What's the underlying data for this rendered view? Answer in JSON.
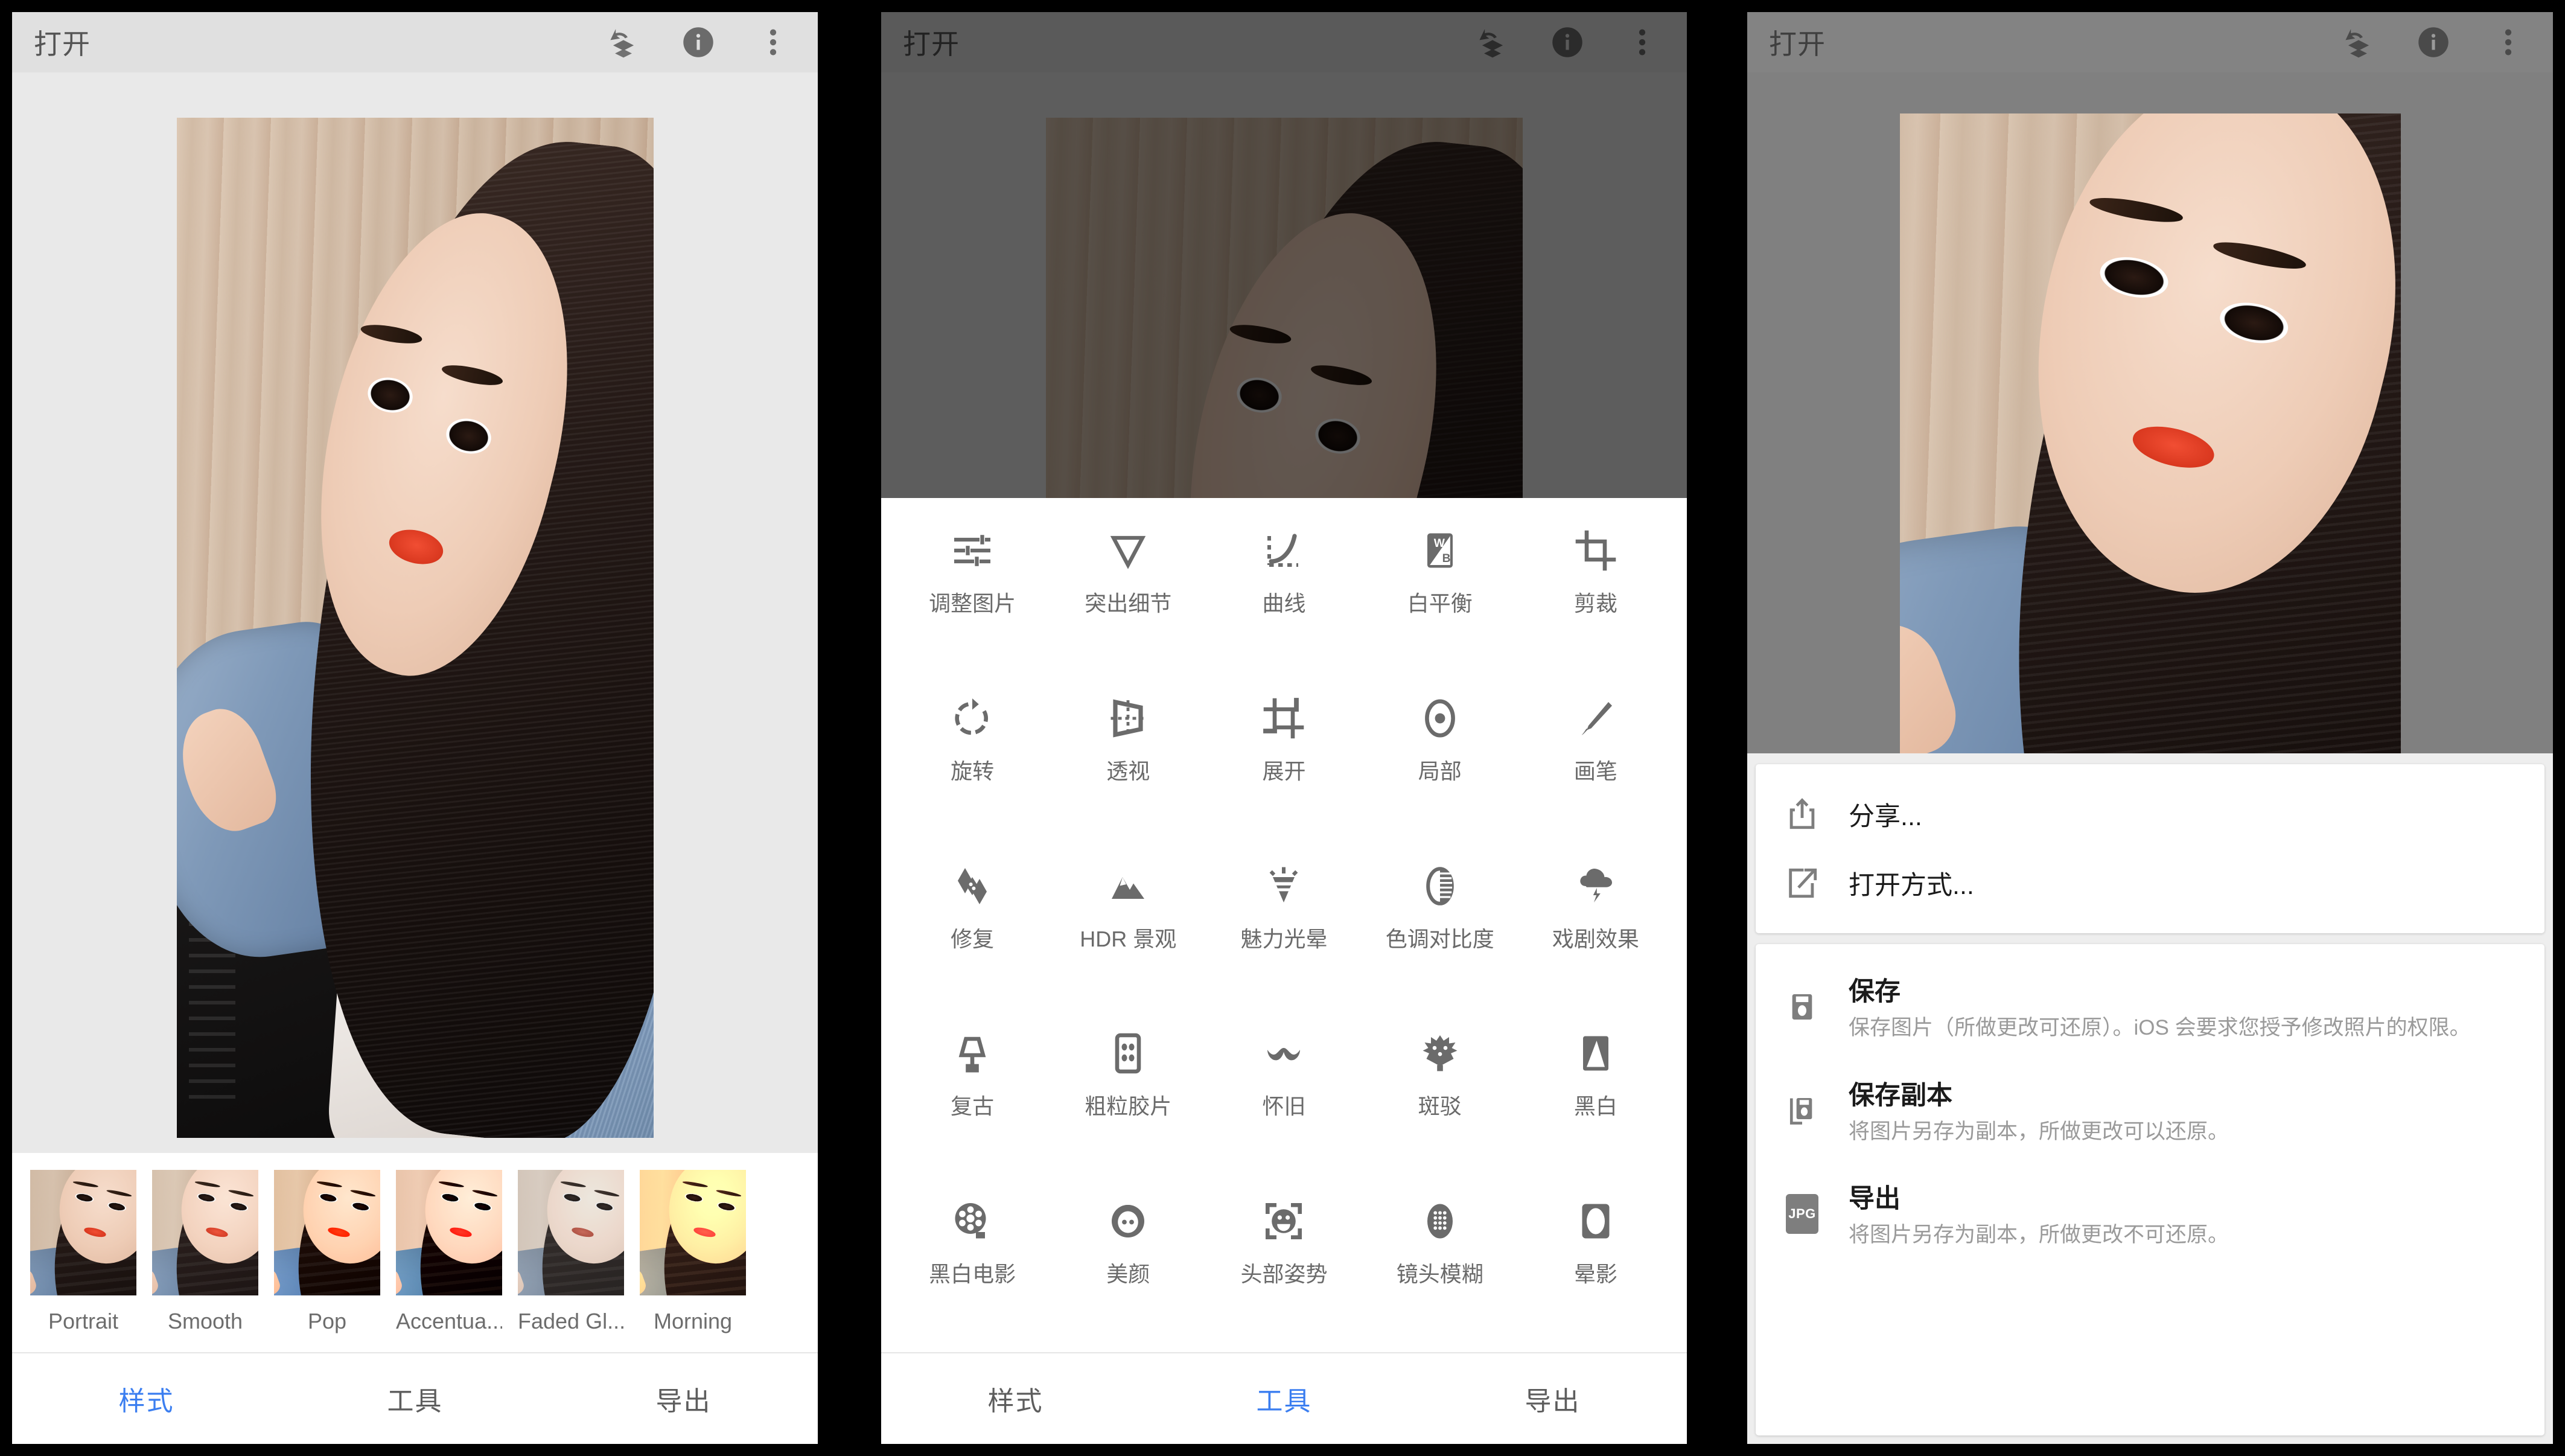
{
  "app": {
    "title": "打开",
    "accent_color": "#3b7ef0",
    "header_icons": [
      {
        "name": "undo-stack-icon",
        "label": "撤消"
      },
      {
        "name": "info-icon",
        "label": "信息"
      },
      {
        "name": "overflow-menu-icon",
        "label": "更多"
      }
    ]
  },
  "tabs": [
    {
      "label": "样式",
      "active_panel1": true
    },
    {
      "label": "工具",
      "active_panel2": true
    },
    {
      "label": "导出",
      "active_panel3": false
    }
  ],
  "panel1": {
    "title": "打开",
    "styles": [
      {
        "label": "Portrait",
        "filter": ""
      },
      {
        "label": "Smooth",
        "filter": "f-smooth"
      },
      {
        "label": "Pop",
        "filter": "f-pop"
      },
      {
        "label": "Accentua...",
        "filter": "f-accent"
      },
      {
        "label": "Faded Gl...",
        "filter": "f-faded"
      },
      {
        "label": "Morning",
        "filter": "f-morning"
      }
    ],
    "tabs": [
      {
        "label": "样式",
        "active": true
      },
      {
        "label": "工具",
        "active": false
      },
      {
        "label": "导出",
        "active": false
      }
    ]
  },
  "panel2": {
    "title": "打开",
    "tools": [
      {
        "label": "调整图片",
        "icon": "tune-sliders-icon"
      },
      {
        "label": "突出细节",
        "icon": "details-triangle-icon"
      },
      {
        "label": "曲线",
        "icon": "curves-icon"
      },
      {
        "label": "白平衡",
        "icon": "white-balance-icon"
      },
      {
        "label": "剪裁",
        "icon": "crop-icon"
      },
      {
        "label": "旋转",
        "icon": "rotate-icon"
      },
      {
        "label": "透视",
        "icon": "perspective-icon"
      },
      {
        "label": "展开",
        "icon": "expand-icon"
      },
      {
        "label": "局部",
        "icon": "selective-icon"
      },
      {
        "label": "画笔",
        "icon": "brush-icon"
      },
      {
        "label": "修复",
        "icon": "healing-icon"
      },
      {
        "label": "HDR 景观",
        "icon": "hdr-scape-icon"
      },
      {
        "label": "魅力光晕",
        "icon": "glamour-glow-icon"
      },
      {
        "label": "色调对比度",
        "icon": "tonal-contrast-icon"
      },
      {
        "label": "戏剧效果",
        "icon": "drama-icon"
      },
      {
        "label": "复古",
        "icon": "vintage-lamp-icon"
      },
      {
        "label": "粗粒胶片",
        "icon": "grainy-film-icon"
      },
      {
        "label": "怀旧",
        "icon": "retrolux-icon"
      },
      {
        "label": "斑驳",
        "icon": "grunge-icon"
      },
      {
        "label": "黑白",
        "icon": "black-white-icon"
      },
      {
        "label": "黑白电影",
        "icon": "noir-reel-icon"
      },
      {
        "label": "美颜",
        "icon": "face-beauty-icon"
      },
      {
        "label": "头部姿势",
        "icon": "head-pose-icon"
      },
      {
        "label": "镜头模糊",
        "icon": "lens-blur-icon"
      },
      {
        "label": "晕影",
        "icon": "vignette-icon"
      }
    ],
    "tabs": [
      {
        "label": "样式",
        "active": false
      },
      {
        "label": "工具",
        "active": true
      },
      {
        "label": "导出",
        "active": false
      }
    ]
  },
  "panel3": {
    "title": "打开",
    "menu_top": [
      {
        "title": "分享...",
        "desc": "",
        "icon": "share-upload-icon"
      },
      {
        "title": "打开方式...",
        "desc": "",
        "icon": "open-external-icon"
      }
    ],
    "menu_bottom": [
      {
        "title": "保存",
        "desc": "保存图片（所做更改可还原）。iOS 会要求您授予修改照片的权限。",
        "icon": "save-disk-icon"
      },
      {
        "title": "保存副本",
        "desc": "将图片另存为副本，所做更改可以还原。",
        "icon": "save-copy-icon"
      },
      {
        "title": "导出",
        "desc": "将图片另存为副本，所做更改不可还原。",
        "icon": "jpg-badge-icon",
        "badge": "JPG"
      }
    ]
  }
}
